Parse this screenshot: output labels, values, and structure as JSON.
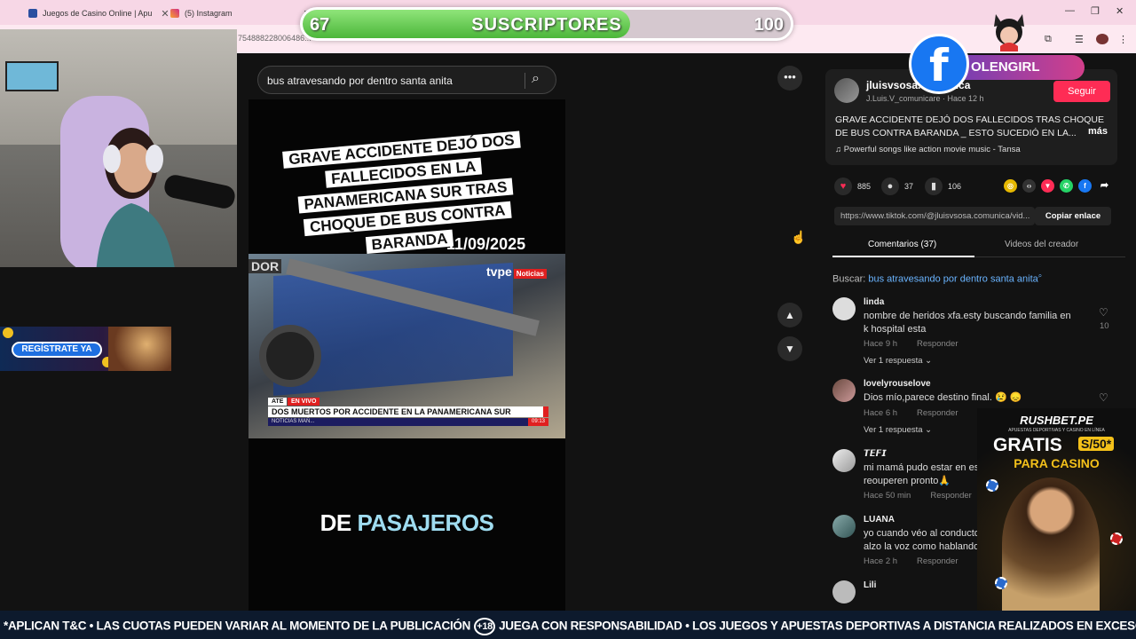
{
  "browser": {
    "tabs": [
      {
        "title": "Juegos de Casino Online | Apu"
      },
      {
        "title": "(5) Instagram"
      }
    ],
    "url_fragment": "754888228006486..."
  },
  "overlay": {
    "subs_current": "67",
    "subs_label": "SUSCRIPTORES",
    "subs_goal": "100",
    "subs_progress": 0.67,
    "fb_letter": "f",
    "fb_name": "OLENGIRL"
  },
  "casino_small": {
    "button": "REGÍSTRATE YA"
  },
  "search": {
    "query": "bus atravesando por dentro santa anita"
  },
  "video": {
    "headline": "GRAVE ACCIDENTE DEJÓ DOS FALLECIDOS EN LA PANAMERICANA SUR TRAS CHOQUE DE BUS CONTRA BARANDA",
    "date": "11/09/2025",
    "left_fragment": "DOR",
    "channel": "tvpe",
    "channel_tag": "Noticias",
    "location": "ATE",
    "live": "EN VIVO",
    "ticker": "DOS MUERTOS POR ACCIDENTE EN LA PANAMERICANA SUR",
    "ticker_sub": "NOTICIAS MAÑ...",
    "ticker_time": "09:13",
    "caption_a": "DE ",
    "caption_b": "PASAJEROS"
  },
  "controls": {
    "more": "•••",
    "up": "▲",
    "down": "▼"
  },
  "post": {
    "author": "jluisvsosa.comunica",
    "author_sub": "J.Luis.V_comunicare · Hace 12 h",
    "follow": "Seguir",
    "description": "GRAVE ACCIDENTE DEJÓ DOS FALLECIDOS TRAS CHOQUE DE BUS CONTRA BARANDA _ ESTO SUCEDIÓ EN LA...",
    "more": "más",
    "music": "♫  Powerful songs like action movie music - Tansa",
    "likes": "885",
    "comments": "37",
    "saves": "106",
    "link": "https://www.tiktok.com/@jluisvsosa.comunica/vid...",
    "copy": "Copiar enlace"
  },
  "tabs": {
    "comments": "Comentarios (37)",
    "creator": "Videos del creador"
  },
  "search_hint": {
    "prefix": "Buscar: ",
    "query": "bus atravesando por dentro santa anita"
  },
  "comments": [
    {
      "name": "linda",
      "text": "nombre de heridos xfa.esty buscando familia en k hospital esta",
      "time": "Hace 9 h",
      "reply": "Responder",
      "likes": "10",
      "replies": "Ver 1 respuesta ⌄"
    },
    {
      "name": "lovelyrouselove",
      "text": "Dios mío,parece destino final. 😢 😞",
      "time": "Hace 6 h",
      "reply": "Responder",
      "likes": "",
      "replies": "Ver 1 respuesta ⌄"
    },
    {
      "name": "𝙏𝙀𝙁𝙄",
      "text": "mi mamá pudo estar en es... reouperen pronto🙏",
      "time": "Hace 50 min",
      "reply": "Responder",
      "likes": "",
      "replies": ""
    },
    {
      "name": "LUANA",
      "text": "yo cuando véo al conducto... alzo la voz como hablando...",
      "time": "Hace 2 h",
      "reply": "Responder",
      "likes": "",
      "replies": ""
    },
    {
      "name": "Lili",
      "text": "",
      "time": "",
      "reply": "",
      "likes": "",
      "replies": ""
    }
  ],
  "rushbet": {
    "brand": "RUSHBET.PE",
    "tagline": "APUESTAS DEPORTIVAS Y CASINO EN LÍNEA",
    "gratis": "GRATIS",
    "amount": "S/50*",
    "para": "PARA CASINO"
  },
  "ticker": {
    "part1": "*APLICAN T&C • LAS CUOTAS PUEDEN VARIAR AL MOMENTO DE LA PUBLICACIÓN",
    "badge": "+18",
    "part2": "JUEGA CON RESPONSABILIDAD • LOS JUEGOS Y APUESTAS DEPORTIVAS A DISTANCIA REALIZADOS EN EXCESO PUEDEN CAUSAR LUDOPATÍA • PROHIBIDO A MENORES DE EDAD."
  },
  "colors": {
    "accent": "#fe2c55",
    "link": "#6ab4ff",
    "facebook": "#1877f2"
  }
}
